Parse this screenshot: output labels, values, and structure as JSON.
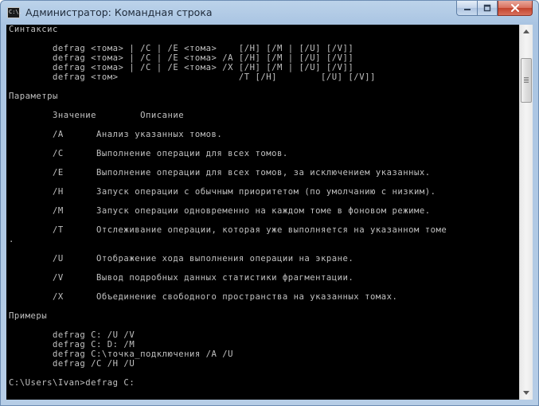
{
  "window": {
    "title": "Администратор: Командная строка",
    "icon_label": "C:\\."
  },
  "icons": {
    "app": "cmd-icon",
    "minimize": "minimize-icon",
    "maximize": "maximize-icon",
    "close": "close-icon",
    "scroll_up": "scroll-up-arrow-icon",
    "scroll_down": "scroll-down-arrow-icon"
  },
  "colors": {
    "console_background": "#000000",
    "console_text": "#c0c0c0",
    "close_button": "#c2432c",
    "frame": "#a9c4e2"
  },
  "console": {
    "lines": [
      "Синтаксис",
      "",
      "        defrag <тома> | /C | /E <тома>    [/H] [/M | [/U] [/V]]",
      "        defrag <тома> | /C | /E <тома> /A [/H] [/M | [/U] [/V]]",
      "        defrag <тома> | /C | /E <тома> /X [/H] [/M | [/U] [/V]]",
      "        defrag <том>                      /T [/H]        [/U] [/V]]",
      "",
      "Параметры",
      "",
      "        Значение        Описание",
      "",
      "        /A      Анализ указанных томов.",
      "",
      "        /C      Выполнение операции для всех томов.",
      "",
      "        /E      Выполнение операции для всех томов, за исключением указанных.",
      "",
      "        /H      Запуск операции с обычным приоритетом (по умолчанию с низким).",
      "",
      "        /M      Запуск операции одновременно на каждом томе в фоновом режиме.",
      "",
      "        /T      Отслеживание операции, которая уже выполняется на указанном томе",
      ".",
      "",
      "        /U      Отображение хода выполнения операции на экране.",
      "",
      "        /V      Вывод подробных данных статистики фрагментации.",
      "",
      "        /X      Объединение свободного пространства на указанных томах.",
      "",
      "Примеры",
      "",
      "        defrag C: /U /V",
      "        defrag C: D: /M",
      "        defrag C:\\точка_подключения /A /U",
      "        defrag /C /H /U",
      "",
      "C:\\Users\\Ivan>defrag C:"
    ]
  }
}
